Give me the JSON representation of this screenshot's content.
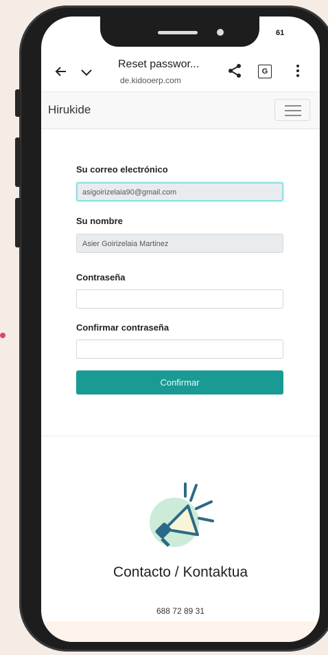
{
  "status_bar": {
    "value": "61"
  },
  "browser": {
    "page_title": "Reset passwor...",
    "url": "de.kidooerp.com",
    "back_icon": "arrow-left-icon",
    "chevron_icon": "chevron-down-icon",
    "share_icon": "share-icon",
    "translate_icon": "translate-icon",
    "translate_glyph": "G",
    "menu_icon": "kebab-menu-icon"
  },
  "site": {
    "brand": "Hirukide"
  },
  "form": {
    "email_label": "Su correo electrónico",
    "email_value": "asigoirizelaia90@gmail.com",
    "name_label": "Su nombre",
    "name_value": "Asier Goirizelaia Martinez",
    "password_label": "Contraseña",
    "password_value": "",
    "confirm_password_label": "Confirmar contraseña",
    "confirm_password_value": "",
    "submit_label": "Confirmar"
  },
  "contact": {
    "title": "Contacto / Kontaktua",
    "phone": "688 72 89 31",
    "icon": "megaphone-icon"
  },
  "colors": {
    "accent": "#1a9a94",
    "focus_border": "#8fe0e0",
    "background": "#f6ece6"
  }
}
